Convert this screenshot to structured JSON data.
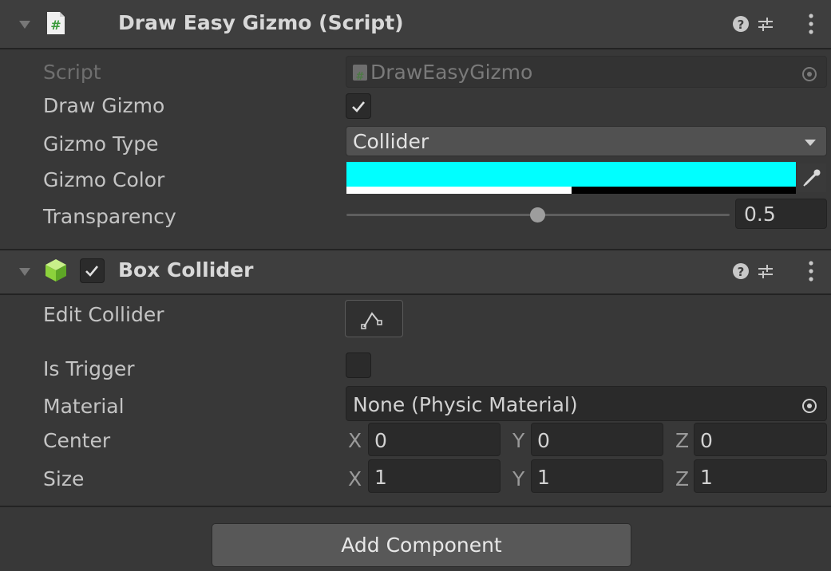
{
  "script_component": {
    "title": "Draw Easy Gizmo (Script)",
    "fields": {
      "script_label": "Script",
      "script_value": "DrawEasyGizmo",
      "draw_gizmo_label": "Draw Gizmo",
      "draw_gizmo_checked": true,
      "gizmo_type_label": "Gizmo Type",
      "gizmo_type_value": "Collider",
      "gizmo_color_label": "Gizmo Color",
      "gizmo_color_hex": "#00ffff",
      "gizmo_color_alpha": 0.5,
      "transparency_label": "Transparency",
      "transparency_value": "0.5",
      "transparency_fraction": 0.5
    }
  },
  "box_collider": {
    "title": "Box Collider",
    "enabled": true,
    "fields": {
      "edit_collider_label": "Edit Collider",
      "is_trigger_label": "Is Trigger",
      "is_trigger_checked": false,
      "material_label": "Material",
      "material_value": "None (Physic Material)",
      "center_label": "Center",
      "center": {
        "x": "0",
        "y": "0",
        "z": "0"
      },
      "size_label": "Size",
      "size": {
        "x": "1",
        "y": "1",
        "z": "1"
      },
      "axis_x": "X",
      "axis_y": "Y",
      "axis_z": "Z"
    }
  },
  "footer": {
    "add_component_label": "Add Component"
  },
  "icons": {
    "script_icon": "csharp-script-icon",
    "collider_icon": "cube-icon",
    "help_icon": "help-icon",
    "presets_icon": "sliders-icon",
    "menu_icon": "kebab-menu-icon",
    "object_picker_icon": "target-circle-icon",
    "eyedropper_icon": "eyedropper-icon",
    "edit_collider_icon": "edit-bounds-icon"
  },
  "colors": {
    "accent_cyan": "#00ffff",
    "cube_green": "#8cd23c",
    "script_green": "#5aa84a"
  }
}
